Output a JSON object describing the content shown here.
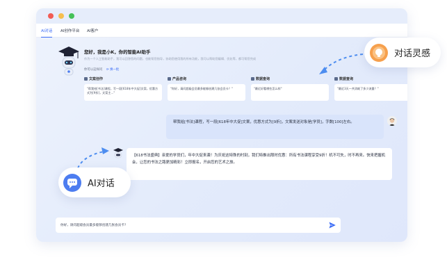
{
  "tabs": [
    "AI对话",
    "AI创作平台",
    "AI客户"
  ],
  "greeting": {
    "title": "您好，我是小K，你的智能AI助手",
    "description": "作为一个人工智能助手，我可以回答您的问题，也能帮您指导，协助您使用我的所有功能，我可以帮助您编辑、优化等，都可帮您完成",
    "ask_prompt": "你可以这样问",
    "refresh_label": "换一批"
  },
  "categories": [
    {
      "title": "文案创作",
      "prompt": "\"帮我给[书法]课程，写一段[618年中大促]文案，优惠方式为[9折]，文案主...\""
    },
    {
      "title": "产品咨询",
      "prompt": "\"你好，请问超级会员最多能够创建几张会员卡？\""
    },
    {
      "title": "数据查询",
      "prompt": "\"最近好看哪些怎么样\""
    },
    {
      "title": "数据查询",
      "prompt": "\"最近3天一共消耗了多少流量？\""
    }
  ],
  "chat": {
    "user_message": "帮我给[书法]课程，写一段[618年中大促]文案，优惠方式为[9折]，文案发送对象是[学员]，字数[100]左右。",
    "bot_reply": "【618书法盛典】亲爱的学员们，年中大促来袭！为庆祝这特殊的时刻，我们特推出限时优惠：所有书法课程享受9折！机不可失，时不再来。快来把握机会，让您的书法之路更加精彩！立即报名，开启您的艺术之旅。"
  },
  "input": {
    "value": "你好，请问超级会员最多能够创建几张会员卡?"
  },
  "floating": {
    "inspiration_label": "对话灵感",
    "ai_chat_label": "AI对话"
  },
  "colors": {
    "accent": "#3b6cf6",
    "user_bubble": "#d9e4fb",
    "inspiration_icon": "#f6a04d",
    "ai_chat_icon": "#4d7df0"
  }
}
